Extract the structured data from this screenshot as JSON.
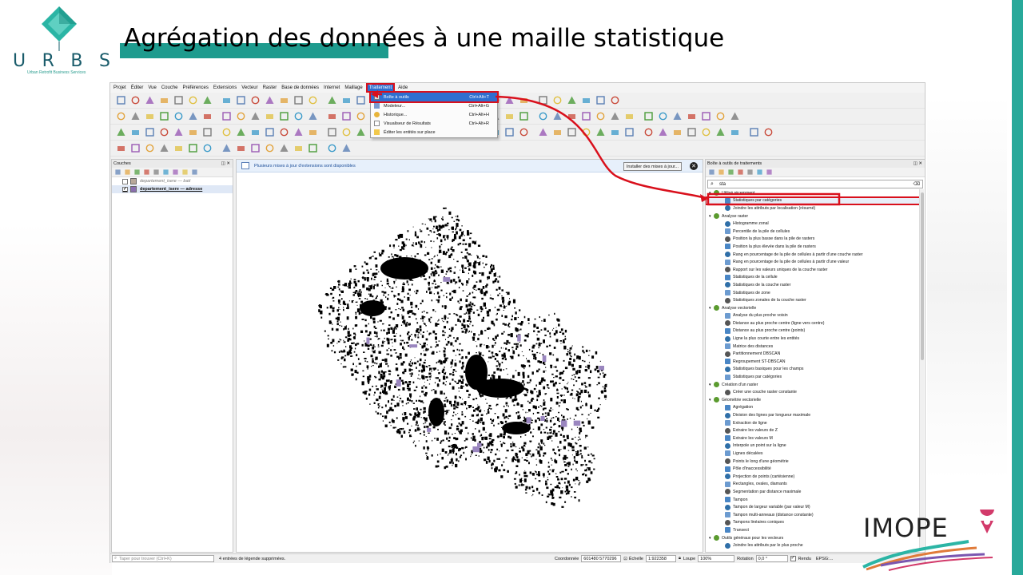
{
  "slide": {
    "title": "Agrégation des données à une maille statistique",
    "logo_left": {
      "letters": [
        "U",
        "R",
        "B",
        "S"
      ],
      "subtitle": "Urban Retrofit Business Services"
    },
    "logo_right": {
      "text": "IMOPE"
    },
    "colors": {
      "accent": "#1e9b8e",
      "side_bar": "#28a99a",
      "highlight": "#d9101c"
    }
  },
  "qgis": {
    "menu": [
      "Projet",
      "Éditer",
      "Vue",
      "Couche",
      "Préférences",
      "Extensions",
      "Vecteur",
      "Raster",
      "Base de données",
      "Internet",
      "Maillage",
      "Traitement",
      "Aide"
    ],
    "active_menu": "Traitement",
    "dropdown": [
      {
        "label": "Boîte à outils",
        "shortcut": "Ctrl+Alt+T",
        "highlighted": true
      },
      {
        "label": "Modeleur...",
        "shortcut": "Ctrl+Alt+G"
      },
      {
        "label": "Historique...",
        "shortcut": "Ctrl+Alt+H"
      },
      {
        "label": "Visualiseur de Résultats",
        "shortcut": "Ctrl+Alt+R"
      },
      {
        "label": "Éditer les entités sur place",
        "shortcut": ""
      }
    ],
    "layers_panel": {
      "title": "Couches",
      "layers": [
        {
          "name": "departement_isere — bati",
          "checked": false,
          "color": "#b8a99a"
        },
        {
          "name": "departement_isere — adresse",
          "checked": true,
          "color": "#8a6fb0"
        }
      ]
    },
    "map": {
      "message": "Plusieurs mises à jour d'extensions sont disponibles",
      "message_button": "Installer des mises à jour...",
      "features_color": "#000000",
      "polygon_color": "#9a86bf"
    },
    "processing": {
      "title": "Boîte à outils de traitements",
      "search_value": "sta",
      "groups": [
        {
          "name": "Utilisé récemment",
          "items": [
            "Statistiques par catégories",
            "Joindre les attributs par localisation (résumé)"
          ]
        },
        {
          "name": "Analyse raster",
          "items": [
            "Histogramme zonal",
            "Percentile de la pile de cellules",
            "Position la plus basse dans la pile de rasters",
            "Position la plus élevée dans la pile de rasters",
            "Rang en pourcentage de la pile de cellules à partir d'une couche raster",
            "Rang en pourcentage de la pile de cellules à partir d'une valeur",
            "Rapport sur les valeurs uniques de la couche raster",
            "Statistiques de la cellule",
            "Statistiques de la couche raster",
            "Statistiques de zone",
            "Statistiques zonales de la couche raster"
          ]
        },
        {
          "name": "Analyse vectorielle",
          "items": [
            "Analyse du plus proche voisin",
            "Distance au plus proche centre (ligne vers centre)",
            "Distance au plus proche centre (points)",
            "Ligne la plus courte entre les entités",
            "Matrice des distances",
            "Partitionnement DBSCAN",
            "Regroupement ST-DBSCAN",
            "Statistiques basiques pour les champs",
            "Statistiques par catégories"
          ]
        },
        {
          "name": "Création d'un raster",
          "items": [
            "Créer une couche raster constante"
          ]
        },
        {
          "name": "Géométrie vectorielle",
          "items": [
            "Agrégation",
            "Division des lignes par longueur maximale",
            "Extraction de ligne",
            "Extraire les valeurs de Z",
            "Extraire les valeurs M",
            "Interpole un point sur la ligne",
            "Lignes décalées",
            "Points le long d'une géométrie",
            "Pôle d'inaccessibilité",
            "Projection de points (cartésienne)",
            "Rectangles, ovales, diamants",
            "Segmentation par distance maximale",
            "Tampon",
            "Tampon de largeur variable (par valeur M)",
            "Tampon multi-anneaux (distance constante)",
            "Tampons linéaires coniques",
            "Transect"
          ]
        },
        {
          "name": "Outils généraux pour les vecteurs",
          "items": [
            "Joindre les attributs par le plus proche"
          ]
        }
      ],
      "selected_item": "Statistiques par catégories"
    },
    "status": {
      "locator_placeholder": "Taper pour trouver (Ctrl+K)",
      "legend_msg": "4 entrées de légende supprimées.",
      "coord_label": "Coordonnée",
      "coord_value": "601480 5770296",
      "scale_label": "Échelle",
      "scale_value": "1:922358",
      "magnifier_label": "Loupe",
      "magnifier_value": "100%",
      "rotation_label": "Rotation",
      "rotation_value": "0,0 °",
      "render_label": "Rendu",
      "crs_value": "EPSG:..."
    }
  }
}
